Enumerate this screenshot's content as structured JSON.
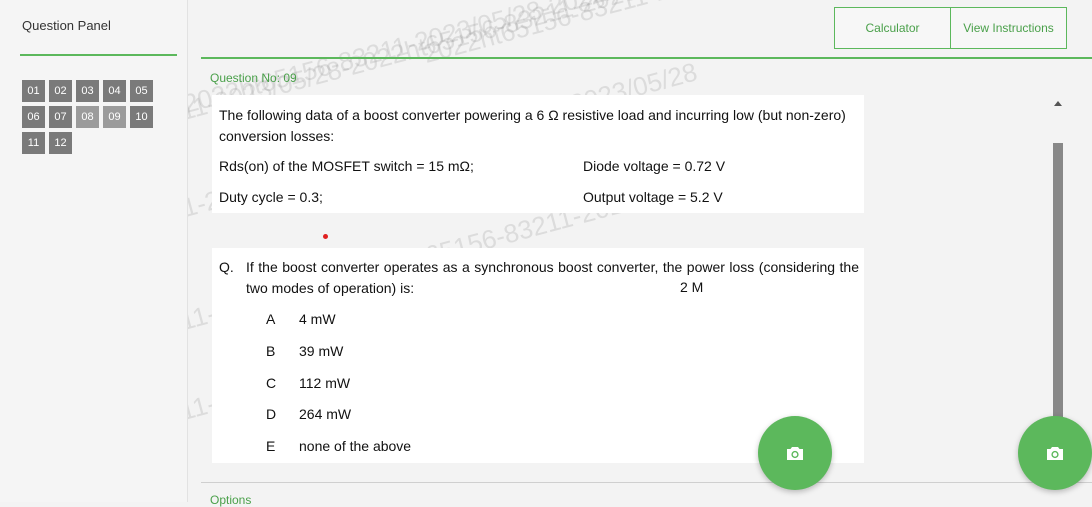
{
  "left_panel": {
    "title": "Question Panel",
    "questions": [
      "01",
      "02",
      "03",
      "04",
      "05",
      "06",
      "07",
      "08",
      "09",
      "10",
      "11",
      "12"
    ]
  },
  "toolbar": {
    "calculator_label": "Calculator",
    "instructions_label": "View Instructions"
  },
  "question": {
    "number_label": "Question No: 09",
    "stem": "The following data of a boost converter powering a 6 Ω resistive load and incurring low (but non-zero) conversion losses:",
    "data": {
      "rds": "Rds(on) of the MOSFET switch = 15 mΩ;",
      "diode": "Diode voltage = 0.72 V",
      "duty": "Duty cycle = 0.3;",
      "vout": "Output voltage = 5.2 V"
    },
    "q_label": "Q.",
    "q_text": "If the boost converter operates as a synchronous boost converter, the power loss (considering the two modes of operation) is:",
    "marks": "2 M",
    "options": [
      {
        "letter": "A",
        "text": "4 mW"
      },
      {
        "letter": "B",
        "text": "39 mW"
      },
      {
        "letter": "C",
        "text": "112 mW"
      },
      {
        "letter": "D",
        "text": "264 mW"
      },
      {
        "letter": "E",
        "text": "none of the above"
      }
    ]
  },
  "footer": {
    "options_label": "Options"
  },
  "watermark": "2022ht65156-83211-2023/05/28-2022ht65156-83211-2023/05/28",
  "colors": {
    "accent": "#5cb85c",
    "tile": "#7a7a7a"
  },
  "icons": {
    "camera": "camera-icon"
  }
}
